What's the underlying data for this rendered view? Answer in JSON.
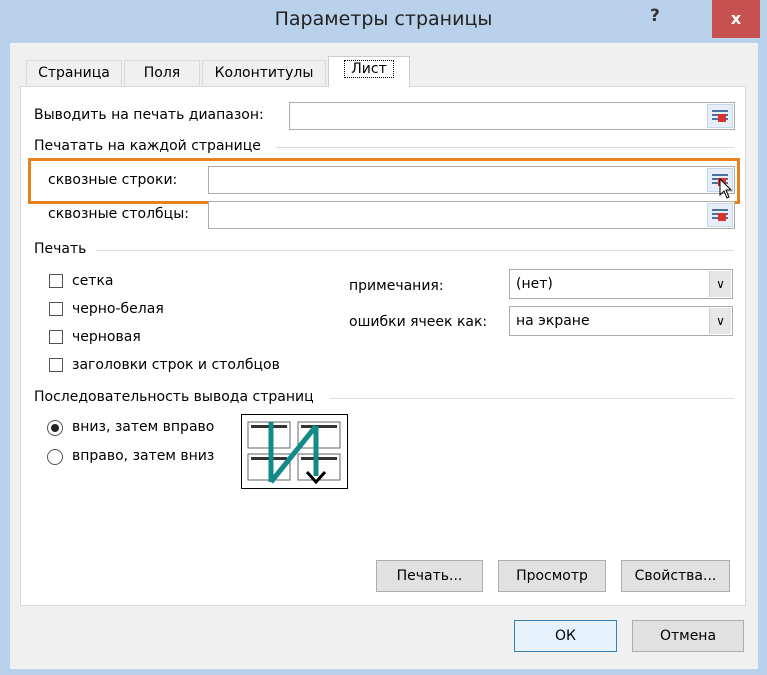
{
  "window": {
    "title": "Параметры страницы",
    "help": "?",
    "close": "x"
  },
  "tabs": [
    {
      "label": "Страница"
    },
    {
      "label": "Поля"
    },
    {
      "label": "Колонтитулы"
    },
    {
      "label": "Лист"
    }
  ],
  "sheet": {
    "print_area_label": "Выводить на печать диапазон:",
    "print_area_value": "",
    "print_titles_header": "Печатать на каждой странице",
    "rows_label": "сквозные строки:",
    "rows_value": "",
    "cols_label": "сквозные столбцы:",
    "cols_value": "",
    "print_header": "Печать",
    "checkboxes": [
      {
        "label": "сетка",
        "checked": false
      },
      {
        "label": "черно-белая",
        "checked": false
      },
      {
        "label": "черновая",
        "checked": false
      },
      {
        "label": "заголовки строк и столбцов",
        "checked": false
      }
    ],
    "comments_label": "примечания:",
    "comments_value": "(нет)",
    "errors_label": "ошибки ячеек как:",
    "errors_value": "на экране",
    "order_header": "Последовательность вывода страниц",
    "order_options": [
      {
        "label": "вниз, затем вправо",
        "selected": true
      },
      {
        "label": "вправо, затем вниз",
        "selected": false
      }
    ],
    "print_button": "Печать...",
    "preview_button": "Просмотр",
    "properties_button": "Свойства...",
    "highlight_color": "#e8821e"
  },
  "footer": {
    "ok": "ОК",
    "cancel": "Отмена"
  }
}
